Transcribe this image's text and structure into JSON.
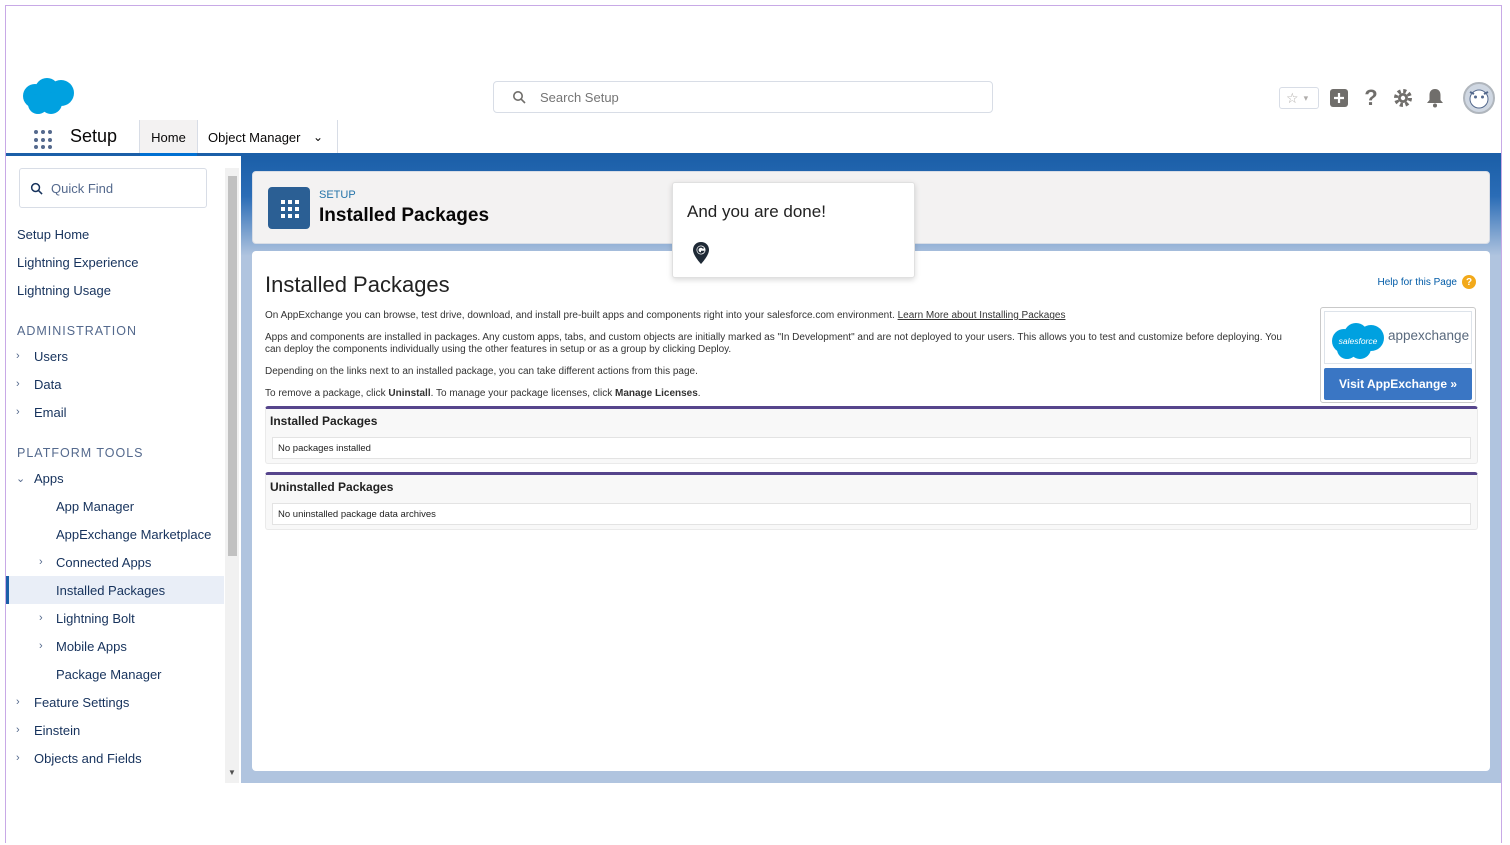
{
  "header": {
    "search_placeholder": "Search Setup",
    "icons": [
      "salesforce-cloud-logo",
      "star-icon",
      "add-icon",
      "help-icon",
      "gear-icon",
      "bell-icon",
      "avatar"
    ]
  },
  "context_bar": {
    "app_name": "Setup",
    "tabs": [
      {
        "label": "Home"
      },
      {
        "label": "Object Manager"
      }
    ]
  },
  "sidebar": {
    "quick_find_placeholder": "Quick Find",
    "items": [
      {
        "label": "Setup Home"
      },
      {
        "label": "Lightning Experience"
      },
      {
        "label": "Lightning Usage"
      }
    ],
    "admin_header": "ADMINISTRATION",
    "admin_items": [
      {
        "label": "Users"
      },
      {
        "label": "Data"
      },
      {
        "label": "Email"
      }
    ],
    "platform_header": "PLATFORM TOOLS",
    "platform_items": [
      {
        "label": "Apps"
      },
      {
        "label": "App Manager"
      },
      {
        "label": "AppExchange Marketplace"
      },
      {
        "label": "Connected Apps"
      },
      {
        "label": "Installed Packages"
      },
      {
        "label": "Lightning Bolt"
      },
      {
        "label": "Mobile Apps"
      },
      {
        "label": "Package Manager"
      },
      {
        "label": "Feature Settings"
      },
      {
        "label": "Einstein"
      },
      {
        "label": "Objects and Fields"
      }
    ]
  },
  "page_header": {
    "eyebrow": "SETUP",
    "title": "Installed Packages"
  },
  "content": {
    "title": "Installed Packages",
    "help_link": "Help for this Page",
    "para1_text": "On AppExchange you can browse, test drive, download, and install pre-built apps and components right into your salesforce.com environment. ",
    "para1_link": "Learn More about Installing Packages",
    "para2": "Apps and components are installed in packages. Any custom apps, tabs, and custom objects are initially marked as \"In Development\" and are not deployed to your users. This allows you to test and customize before deploying. You can deploy the components individually using the other features in setup or as a group by clicking Deploy.",
    "para3": "Depending on the links next to an installed package, you can take different actions from this page.",
    "para4_a": "To remove a package, click ",
    "para4_b": "Uninstall",
    "para4_c": ". To manage your package licenses, click ",
    "para4_d": "Manage Licenses",
    "para4_e": ".",
    "appexchange": {
      "cloud_text": "salesforce",
      "word": "appexchange",
      "button": "Visit AppExchange »"
    },
    "sections": [
      {
        "title": "Installed Packages",
        "row": "No packages installed"
      },
      {
        "title": "Uninstalled Packages",
        "row": "No uninstalled package data archives"
      }
    ]
  },
  "tooltip": {
    "text": "And you are done!"
  },
  "colors": {
    "brand_blue": "#1b5fa8",
    "salesforce_cloud": "#00a1e0",
    "appexchange_button": "#3a76c4",
    "section_accent": "#56458c"
  }
}
